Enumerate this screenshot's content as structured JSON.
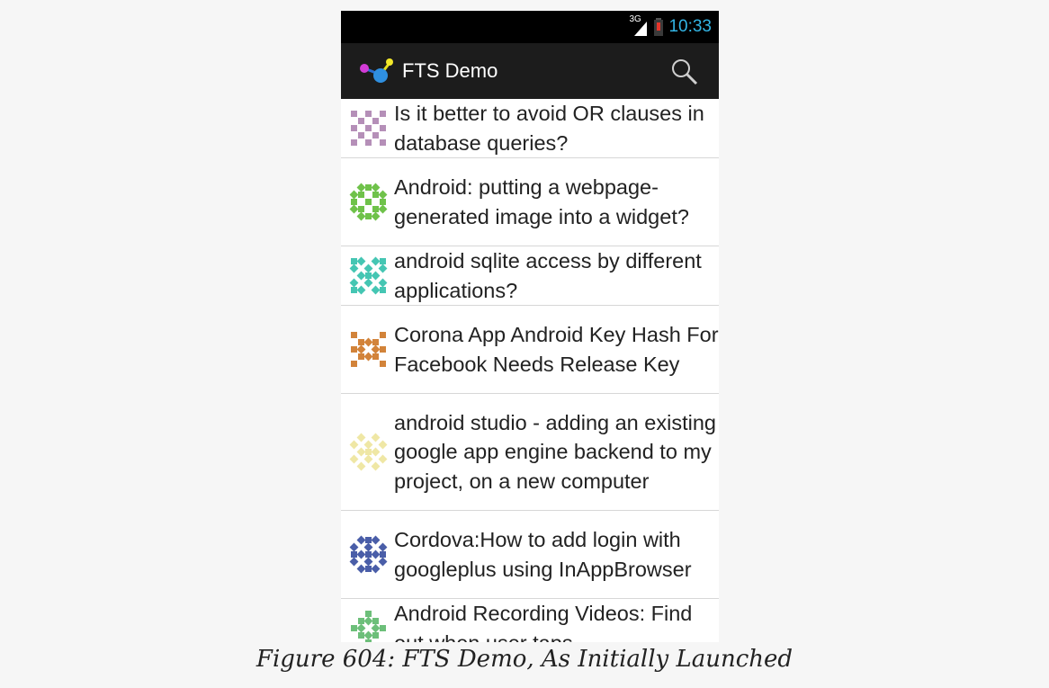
{
  "status_bar": {
    "network": "3G",
    "time": "10:33"
  },
  "action_bar": {
    "title": "FTS Demo",
    "icons": {
      "logo": "app-logo-icon",
      "search": "search-icon"
    }
  },
  "colors": {
    "accent": "#33b5e5",
    "action_bar": "#1c1c1c",
    "status_bar": "#000000",
    "battery_low": "#e6352b"
  },
  "questions": [
    {
      "title": "Is it better to avoid OR clauses in database queries?",
      "color": "#b58fb8"
    },
    {
      "title": "Android: putting a webpage-generated image into a widget?",
      "color": "#6fc24a"
    },
    {
      "title": "android sqlite access by different applications?",
      "color": "#45c6b3"
    },
    {
      "title": "Corona App Android Key Hash For Facebook Needs Release Key",
      "color": "#d2833a"
    },
    {
      "title": "android studio - adding an existing google app engine backend to my project, on a new computer",
      "color": "#efe7a5"
    },
    {
      "title": "Cordova:How to add login with googleplus using InAppBrowser",
      "color": "#4a5ea8"
    },
    {
      "title": "Android Recording Videos: Find out when user taps",
      "color": "#6dbf7a"
    }
  ],
  "caption": "Figure 604: FTS Demo, As Initially Launched"
}
